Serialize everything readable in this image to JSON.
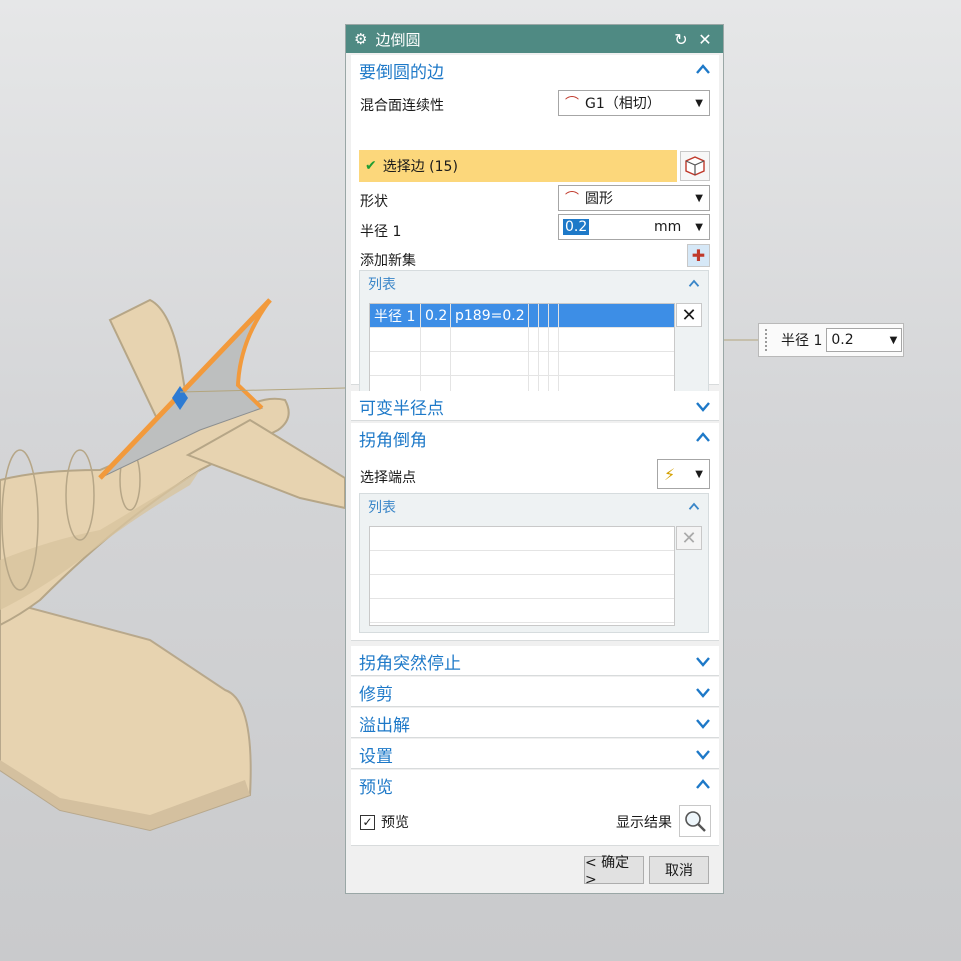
{
  "dialog": {
    "title": "边倒圆",
    "reset_icon": "reset-icon",
    "close_icon": "close-icon"
  },
  "edges_section": {
    "title": "要倒圆的边",
    "blend_continuity_label": "混合面连续性",
    "blend_continuity_value": "G1（相切）",
    "select_edge_label": "选择边 (15)",
    "shape_label": "形状",
    "shape_value": "圆形",
    "radius_label": "半径 1",
    "radius_value": "0.2",
    "radius_unit": "mm",
    "add_new_set_label": "添加新集",
    "list_title": "列表",
    "list_rows": [
      {
        "c1": "半径 1",
        "c2": "0.2",
        "c3": "p189=0.2"
      }
    ]
  },
  "variable_radius_section": {
    "title": "可变半径点"
  },
  "corner_setback_section": {
    "title": "拐角倒角",
    "select_endpoint_label": "选择端点",
    "list_title": "列表"
  },
  "corner_stop_section": {
    "title": "拐角突然停止"
  },
  "trim_section": {
    "title": "修剪"
  },
  "overflow_section": {
    "title": "溢出解"
  },
  "settings_section": {
    "title": "设置"
  },
  "preview_section": {
    "title": "预览",
    "preview_checkbox_label": "预览",
    "preview_checked": true,
    "show_result_label": "显示结果"
  },
  "buttons": {
    "ok": "< 确定 >",
    "cancel": "取消"
  },
  "onscreen_input": {
    "label": "半径 1",
    "value": "0.2"
  },
  "colors": {
    "titlebar": "#4f8a83",
    "accent": "#1e79c8",
    "selection_bar": "#fcd77b",
    "edge_highlight": "#f29a3c",
    "model": "#e7d3b0"
  }
}
